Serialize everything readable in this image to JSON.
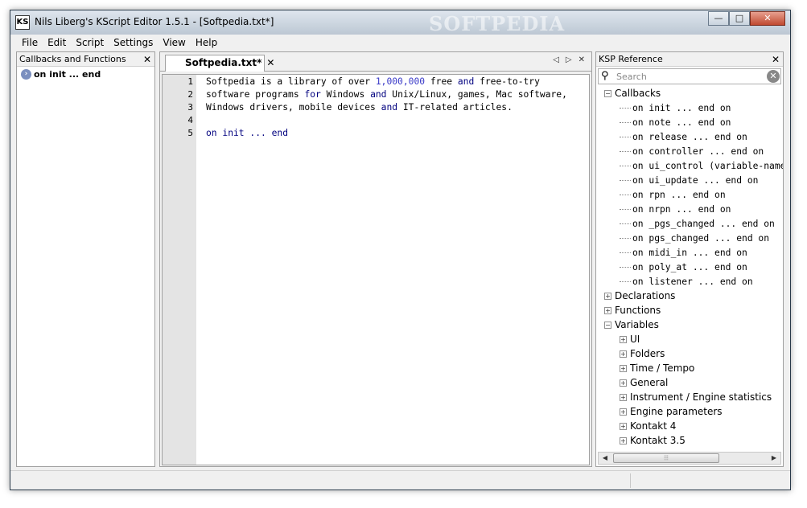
{
  "window": {
    "title": "Nils Liberg's KScript Editor 1.5.1 - [Softpedia.txt*]",
    "icon_label": "KS",
    "watermark": "SOFTPEDIA",
    "min_glyph": "—",
    "max_glyph": "□",
    "close_glyph": "✕"
  },
  "menu": [
    "File",
    "Edit",
    "Script",
    "Settings",
    "View",
    "Help"
  ],
  "left_panel": {
    "title": "Callbacks and Functions",
    "close_glyph": "✕",
    "items": [
      {
        "label": "on init ... end",
        "icon_glyph": "›"
      }
    ]
  },
  "editor": {
    "tab_label": "Softpedia.txt*",
    "tab_close_glyph": "✕",
    "nav_prev": "◁",
    "nav_next": "▷",
    "nav_close": "✕",
    "line_numbers": [
      "1",
      "2",
      "3",
      "4",
      "5"
    ],
    "lines": [
      [
        {
          "t": "Softpedia is a library of over ",
          "c": "n"
        },
        {
          "t": "1,000,000",
          "c": "num"
        },
        {
          "t": " free ",
          "c": "n"
        },
        {
          "t": "and",
          "c": "kw"
        },
        {
          "t": " free-to-try",
          "c": "n"
        }
      ],
      [
        {
          "t": "software programs ",
          "c": "n"
        },
        {
          "t": "for",
          "c": "kw"
        },
        {
          "t": " Windows ",
          "c": "n"
        },
        {
          "t": "and",
          "c": "kw"
        },
        {
          "t": " Unix/Linux, games, Mac software,",
          "c": "n"
        }
      ],
      [
        {
          "t": "Windows drivers, mobile devices ",
          "c": "n"
        },
        {
          "t": "and",
          "c": "kw"
        },
        {
          "t": " IT-related articles.",
          "c": "n"
        }
      ],
      [],
      [
        {
          "t": "on init ... end",
          "c": "kw"
        }
      ]
    ]
  },
  "right_panel": {
    "title": "KSP Reference",
    "close_glyph": "✕",
    "search_placeholder": "Search",
    "search_icon_glyph": "⚲",
    "clear_glyph": "✕",
    "tree": [
      {
        "label": "Callbacks",
        "level": 0,
        "expander": "−",
        "mono": false
      },
      {
        "label": "on init ... end on",
        "level": 1,
        "mono": true
      },
      {
        "label": "on note ... end on",
        "level": 1,
        "mono": true
      },
      {
        "label": "on release ... end on",
        "level": 1,
        "mono": true
      },
      {
        "label": "on controller ... end on",
        "level": 1,
        "mono": true
      },
      {
        "label": "on ui_control (variable-name) ... end on",
        "level": 1,
        "mono": true
      },
      {
        "label": "on ui_update ... end on",
        "level": 1,
        "mono": true
      },
      {
        "label": "on rpn ... end on",
        "level": 1,
        "mono": true
      },
      {
        "label": "on nrpn ... end on",
        "level": 1,
        "mono": true
      },
      {
        "label": "on _pgs_changed ... end on",
        "level": 1,
        "mono": true
      },
      {
        "label": "on pgs_changed ... end on",
        "level": 1,
        "mono": true
      },
      {
        "label": "on midi_in ... end on",
        "level": 1,
        "mono": true
      },
      {
        "label": "on poly_at ... end on",
        "level": 1,
        "mono": true
      },
      {
        "label": "on listener ... end on",
        "level": 1,
        "mono": true
      },
      {
        "label": "Declarations",
        "level": 0,
        "expander": "+",
        "mono": false
      },
      {
        "label": "Functions",
        "level": 0,
        "expander": "+",
        "mono": false
      },
      {
        "label": "Variables",
        "level": 0,
        "expander": "−",
        "mono": false
      },
      {
        "label": "UI",
        "level": 1,
        "expander": "+",
        "mono": false
      },
      {
        "label": "Folders",
        "level": 1,
        "expander": "+",
        "mono": false
      },
      {
        "label": "Time / Tempo",
        "level": 1,
        "expander": "+",
        "mono": false
      },
      {
        "label": "General",
        "level": 1,
        "expander": "+",
        "mono": false
      },
      {
        "label": "Instrument / Engine statistics",
        "level": 1,
        "expander": "+",
        "mono": false
      },
      {
        "label": "Engine parameters",
        "level": 1,
        "expander": "+",
        "mono": false
      },
      {
        "label": "Kontakt 4",
        "level": 1,
        "expander": "+",
        "mono": false
      },
      {
        "label": "Kontakt 3.5",
        "level": 1,
        "expander": "+",
        "mono": false
      }
    ],
    "scroll_left": "◀",
    "scroll_right": "▶",
    "scroll_thumb_grip": "⦙⦙⦙"
  }
}
